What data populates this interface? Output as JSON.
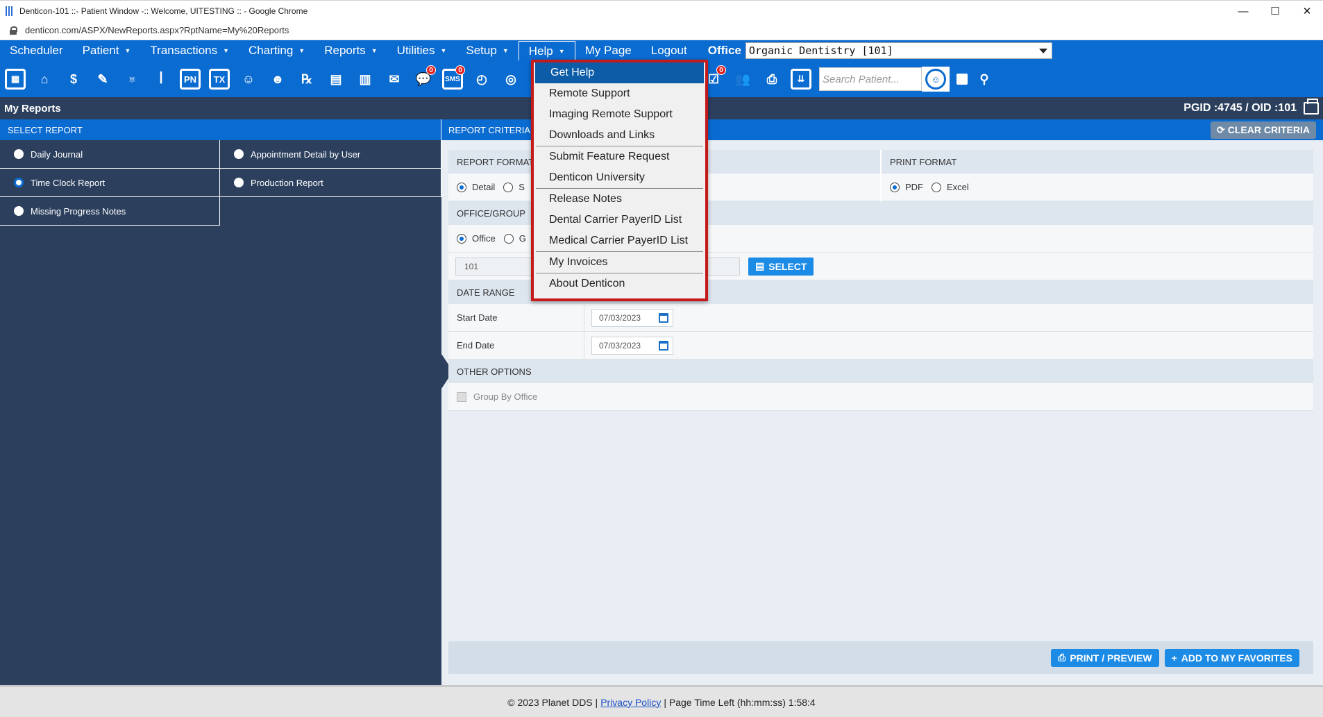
{
  "window": {
    "title": "Denticon-101 ::- Patient Window -:: Welcome, UITESTING :: - Google Chrome",
    "url": "denticon.com/ASPX/NewReports.aspx?RptName=My%20Reports",
    "controls": [
      "—",
      "☐",
      "✕"
    ]
  },
  "nav": {
    "items": [
      {
        "label": "Scheduler",
        "caret": false
      },
      {
        "label": "Patient",
        "caret": true
      },
      {
        "label": "Transactions",
        "caret": true
      },
      {
        "label": "Charting",
        "caret": true
      },
      {
        "label": "Reports",
        "caret": true
      },
      {
        "label": "Utilities",
        "caret": true
      },
      {
        "label": "Setup",
        "caret": true
      },
      {
        "label": "Help",
        "caret": true,
        "active": true
      },
      {
        "label": "My Page",
        "caret": false
      },
      {
        "label": "Logout",
        "caret": false
      }
    ],
    "office_label": "Office",
    "office_value": "Organic Dentistry [101]"
  },
  "toolbar": {
    "search_placeholder": "Search Patient...",
    "sms_badge": "0",
    "chat_badge": "0",
    "task_badge": "0"
  },
  "page": {
    "title": "My Reports",
    "ids": "PGID :4745  /  OID :101"
  },
  "select_report": {
    "header": "SELECT REPORT",
    "reports": [
      "Daily Journal",
      "Appointment Detail by User",
      "Time Clock Report",
      "Production Report",
      "Missing Progress Notes"
    ],
    "selected": "Time Clock Report"
  },
  "criteria": {
    "header": "REPORT CRITERIA",
    "clear_label": "CLEAR CRITERIA",
    "report_format_label": "REPORT FORMAT",
    "format_detail": "Detail",
    "format_summary": "S",
    "print_format_label": "PRINT FORMAT",
    "print_pdf": "PDF",
    "print_excel": "Excel",
    "office_group_label": "OFFICE/GROUP",
    "office_opt": "Office",
    "group_opt": "G",
    "office_value": "101",
    "select_label": "SELECT",
    "date_range_label": "DATE RANGE",
    "start_label": "Start Date",
    "start_value": "07/03/2023",
    "end_label": "End Date",
    "end_value": "07/03/2023",
    "other_label": "OTHER OPTIONS",
    "group_by_office": "Group By Office",
    "print_btn": "PRINT / PREVIEW",
    "fav_btn": "ADD TO MY FAVORITES"
  },
  "footer": {
    "copyright": "© 2023 Planet DDS |",
    "privacy": "Privacy Policy",
    "time_left": "| Page Time Left (hh:mm:ss) 1:58:4"
  },
  "help_menu": {
    "items": [
      "Get Help",
      "Remote Support",
      "Imaging Remote Support",
      "Downloads and Links",
      "Submit Feature Request",
      "Denticon University",
      "Release Notes",
      "Dental Carrier PayerID List",
      "Medical Carrier PayerID List",
      "My Invoices",
      "About Denticon"
    ],
    "highlighted": "Get Help"
  },
  "colors": {
    "nav_blue": "#0a6bd1",
    "dark_panel": "#2c405e",
    "menu_border": "#c41a1a"
  }
}
